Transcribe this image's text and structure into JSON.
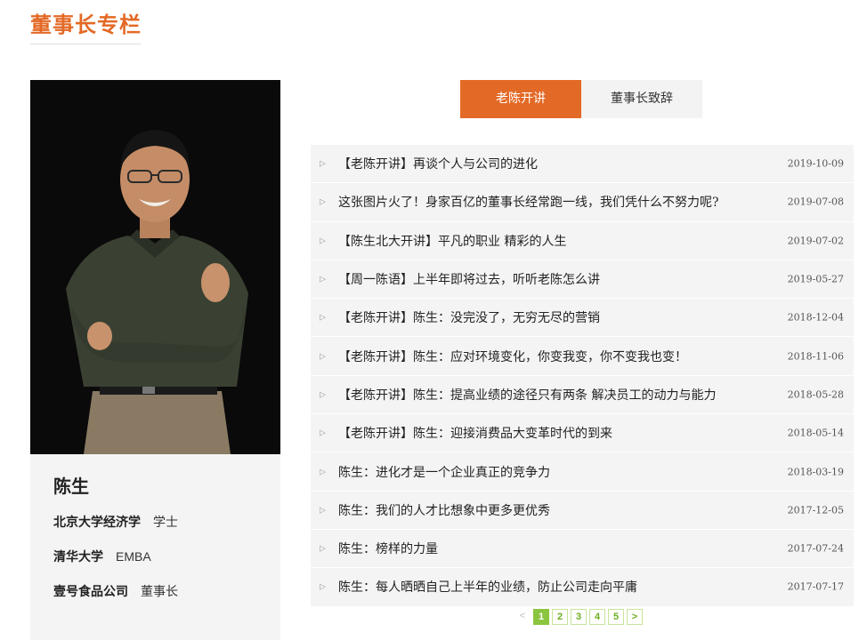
{
  "page": {
    "title": "董事长专栏"
  },
  "profile": {
    "name": "陈生",
    "credentials": [
      {
        "org": "北京大学经济学",
        "value": "学士"
      },
      {
        "org": "清华大学",
        "value": "EMBA"
      },
      {
        "org": "壹号食品公司",
        "value": "董事长"
      }
    ]
  },
  "tabs": [
    {
      "label": "老陈开讲",
      "active": true
    },
    {
      "label": "董事长致辞",
      "active": false
    }
  ],
  "articles": [
    {
      "title": "【老陈开讲】再谈个人与公司的进化",
      "date": "2019-10-09"
    },
    {
      "title": "这张图片火了！身家百亿的董事长经常跑一线，我们凭什么不努力呢?",
      "date": "2019-07-08"
    },
    {
      "title": "【陈生北大开讲】平凡的职业 精彩的人生",
      "date": "2019-07-02"
    },
    {
      "title": "【周一陈语】上半年即将过去，听听老陈怎么讲",
      "date": "2019-05-27"
    },
    {
      "title": "【老陈开讲】陈生：没完没了，无穷无尽的营销",
      "date": "2018-12-04"
    },
    {
      "title": "【老陈开讲】陈生：应对环境变化，你变我变，你不变我也变！",
      "date": "2018-11-06"
    },
    {
      "title": "【老陈开讲】陈生：提高业绩的途径只有两条 解决员工的动力与能力",
      "date": "2018-05-28"
    },
    {
      "title": "【老陈开讲】陈生：迎接消费品大变革时代的到来",
      "date": "2018-05-14"
    },
    {
      "title": "陈生：进化才是一个企业真正的竞争力",
      "date": "2018-03-19"
    },
    {
      "title": "陈生：我们的人才比想象中更多更优秀",
      "date": "2017-12-05"
    },
    {
      "title": "陈生：榜样的力量",
      "date": "2017-07-24"
    },
    {
      "title": "陈生：每人晒晒自己上半年的业绩，防止公司走向平庸",
      "date": "2017-07-17"
    }
  ],
  "pagination": {
    "prev": "<",
    "pages": [
      "1",
      "2",
      "3",
      "4",
      "5"
    ],
    "current": "1",
    "next": ">"
  },
  "colors": {
    "accent": "#e36a26",
    "pager": "#8bc53f",
    "panel": "#f4f4f4"
  },
  "icons": {
    "bullet": "triangle-right-outline-icon"
  }
}
